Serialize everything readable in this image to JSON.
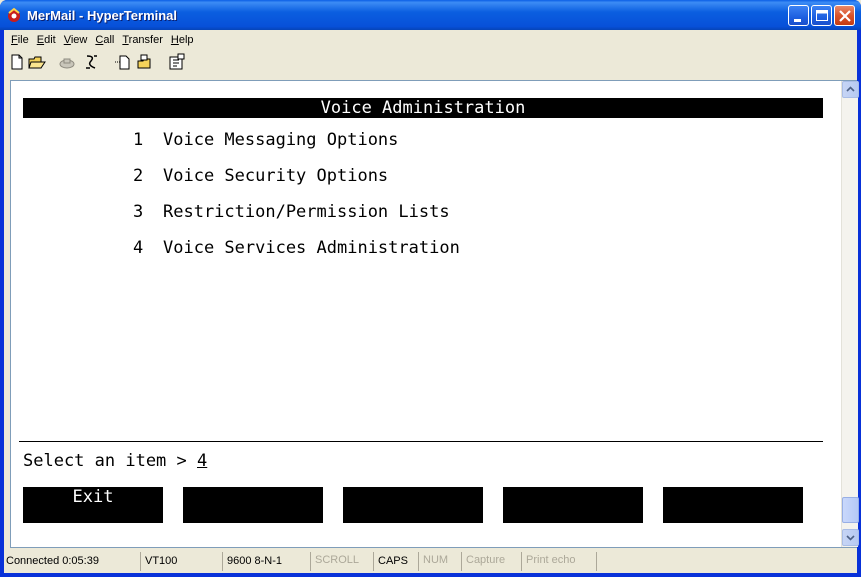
{
  "window": {
    "title": "MerMail - HyperTerminal",
    "accent_color": "#0a5fe6",
    "icons": [
      "app-icon",
      "minimize-icon",
      "maximize-icon",
      "close-icon"
    ]
  },
  "menubar": {
    "items": [
      {
        "label": "File",
        "mnemonic": "F"
      },
      {
        "label": "Edit",
        "mnemonic": "E"
      },
      {
        "label": "View",
        "mnemonic": "V"
      },
      {
        "label": "Call",
        "mnemonic": "C"
      },
      {
        "label": "Transfer",
        "mnemonic": "T"
      },
      {
        "label": "Help",
        "mnemonic": "H"
      }
    ]
  },
  "toolbar": {
    "icons": [
      "new-icon",
      "open-icon",
      "call-icon",
      "disconnect-icon",
      "send-icon",
      "receive-icon",
      "properties-icon"
    ]
  },
  "terminal": {
    "header": "Voice Administration",
    "options": [
      {
        "number": "1",
        "label": "Voice Messaging Options"
      },
      {
        "number": "2",
        "label": "Voice Security Options"
      },
      {
        "number": "3",
        "label": "Restriction/Permission Lists"
      },
      {
        "number": "4",
        "label": "Voice Services Administration"
      }
    ],
    "prompt": "Select an item > ",
    "prompt_value": "4",
    "function_keys": [
      "Exit",
      "",
      "",
      "",
      ""
    ]
  },
  "statusbar": {
    "connection": "Connected 0:05:39",
    "emulation": "VT100",
    "settings": "9600 8-N-1",
    "scroll": "SCROLL",
    "caps": "CAPS",
    "num": "NUM",
    "capture": "Capture",
    "print_echo": "Print echo"
  }
}
